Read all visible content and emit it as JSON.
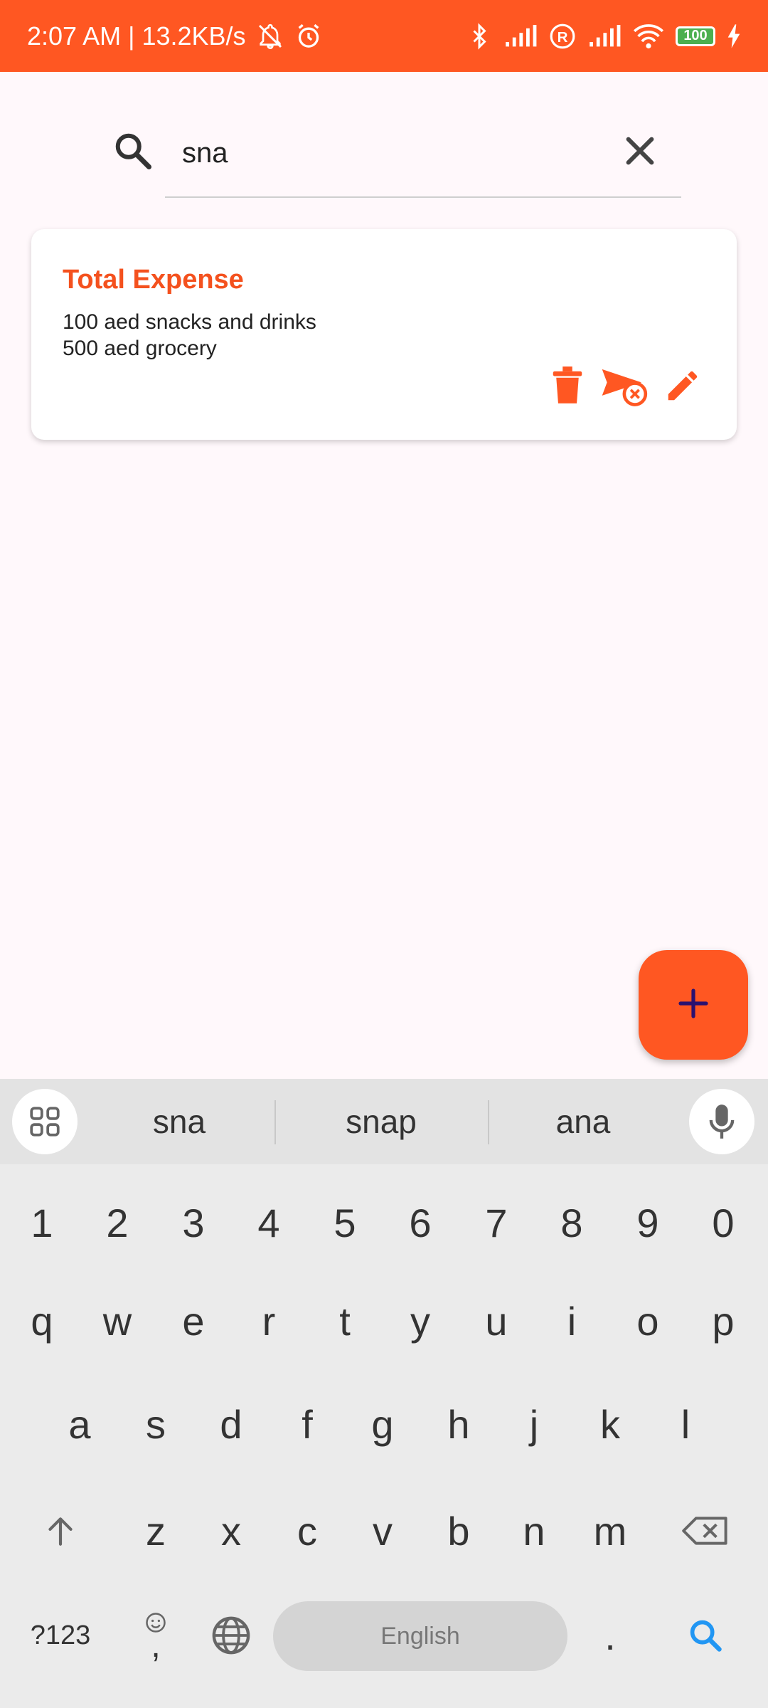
{
  "status_bar": {
    "time_speed": "2:07 AM | 13.2KB/s",
    "battery": "100",
    "icons": [
      "mute-bell-icon",
      "alarm-icon",
      "bluetooth-icon",
      "signal-icon",
      "roaming-icon",
      "signal-icon",
      "wifi-icon",
      "battery-icon",
      "charging-icon"
    ]
  },
  "search": {
    "value": "sna",
    "placeholder": "",
    "icon": "search-icon",
    "clear_icon": "close-icon"
  },
  "card": {
    "title": "Total Expense",
    "body": "100 aed snacks and drinks\n500 aed grocery",
    "actions": [
      "delete-icon",
      "send-cancel-icon",
      "edit-icon"
    ]
  },
  "fab": {
    "icon": "plus-icon"
  },
  "keyboard": {
    "suggestions": [
      "sna",
      "snap",
      "ana"
    ],
    "row_numbers": [
      "1",
      "2",
      "3",
      "4",
      "5",
      "6",
      "7",
      "8",
      "9",
      "0"
    ],
    "row1": [
      "q",
      "w",
      "e",
      "r",
      "t",
      "y",
      "u",
      "i",
      "o",
      "p"
    ],
    "row2": [
      "a",
      "s",
      "d",
      "f",
      "g",
      "h",
      "j",
      "k",
      "l"
    ],
    "row3": [
      "z",
      "x",
      "c",
      "v",
      "b",
      "n",
      "m"
    ],
    "symbols_key": "?123",
    "comma_key": ",",
    "period_key": ".",
    "space_label": "English"
  },
  "colors": {
    "accent": "#FF5722",
    "title": "#F4511E",
    "background": "#FFF8FB",
    "keyboard_bg": "#EBEBEB",
    "search_key": "#2196F3"
  }
}
